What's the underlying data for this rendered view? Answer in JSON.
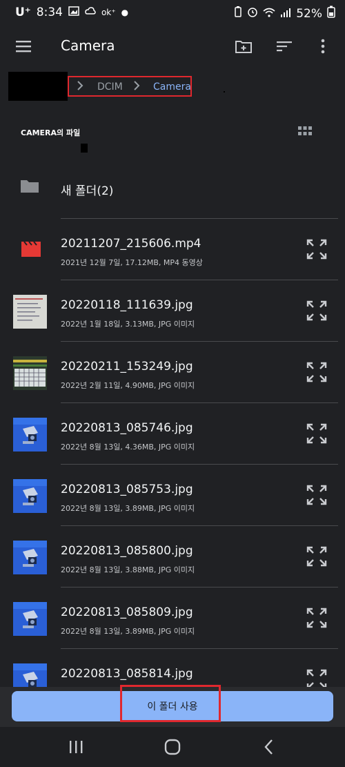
{
  "status_bar": {
    "carrier": "U⁺",
    "time": "8:34",
    "battery": "52%"
  },
  "app_bar": {
    "title": "Camera"
  },
  "breadcrumb": {
    "items": [
      "DCIM",
      "Camera"
    ]
  },
  "section": {
    "label": "CAMERA의 파일"
  },
  "folder_item": {
    "name": "새 폴더(2)"
  },
  "files": [
    {
      "name": "20211207_215606.mp4",
      "meta": "2021년 12월 7일, 17.12MB, MP4 동영상",
      "type": "video"
    },
    {
      "name": "20220118_111639.jpg",
      "meta": "2022년 1월 18일, 3.13MB, JPG 이미지",
      "type": "paper"
    },
    {
      "name": "20220211_153249.jpg",
      "meta": "2022년 2월 11일, 4.90MB, JPG 이미지",
      "type": "calendar"
    },
    {
      "name": "20220813_085746.jpg",
      "meta": "2022년 8월 13일, 4.36MB, JPG 이미지",
      "type": "blue"
    },
    {
      "name": "20220813_085753.jpg",
      "meta": "2022년 8월 13일, 3.89MB, JPG 이미지",
      "type": "blue"
    },
    {
      "name": "20220813_085800.jpg",
      "meta": "2022년 8월 13일, 3.88MB, JPG 이미지",
      "type": "blue"
    },
    {
      "name": "20220813_085809.jpg",
      "meta": "2022년 8월 13일, 3.89MB, JPG 이미지",
      "type": "blue"
    },
    {
      "name": "20220813_085814.jpg",
      "meta": "",
      "type": "blue"
    }
  ],
  "use_folder_button": {
    "label": "이 폴더 사용"
  },
  "colors": {
    "accent": "#8ab4f8",
    "highlight": "#e0282e",
    "video_icon": "#e53935"
  }
}
